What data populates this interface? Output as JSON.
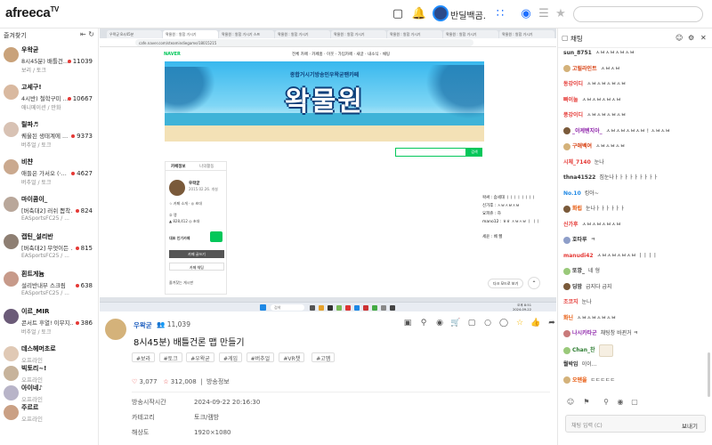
{
  "brand": {
    "logo": "afreeca",
    "logo_tv": "TV"
  },
  "header": {
    "user_name": "반딜백곰.",
    "icons": [
      "broadcast-icon",
      "bell-icon",
      "apps-icon",
      "chat-bubble-icon",
      "menu-icon",
      "star-icon"
    ]
  },
  "sidebar": {
    "title": "즐겨찾기",
    "items": [
      {
        "name": "우왁굳",
        "title": "8시45분) 배틀건...",
        "category": "보리 / 토크",
        "viewers": "11039",
        "online": true
      },
      {
        "name": "고세구!",
        "title": "4시반) 철학구미 ...",
        "category": "애니메이션 / 만화",
        "viewers": "10667",
        "online": true
      },
      {
        "name": "릴파♬",
        "title": "퀘울된 생태계에 ...",
        "category": "버추얼 / 토크",
        "viewers": "9373",
        "online": true
      },
      {
        "name": "비챤",
        "title": "애들은 가서오 (·...",
        "category": "버추얼 / 토크",
        "viewers": "4627",
        "online": true
      },
      {
        "name": "마이콤이_",
        "title": "[버축대2] 러쉬 뽑착...",
        "category": "EASportsFC25 / ...",
        "viewers": "824",
        "online": true
      },
      {
        "name": "캡틴_설리반",
        "title": "[버축대2] 무엇이든 ...",
        "category": "EASportsFC25 / ...",
        "viewers": "815",
        "online": true
      },
      {
        "name": "흰트게늄",
        "title": "설리반내부 스크림",
        "category": "EASportsFC25 / ...",
        "viewers": "638",
        "online": true
      },
      {
        "name": "이르_MIR",
        "title": "콘서트 후열! 이무지...",
        "category": "버추얼 / 토크",
        "viewers": "386",
        "online": true
      },
      {
        "name": "데스헤머초로",
        "offline": "오프라인"
      },
      {
        "name": "빅토리~!",
        "offline": "오프라인"
      },
      {
        "name": "아이네♪",
        "offline": "오프라인"
      },
      {
        "name": "주르르",
        "offline": "오프라인"
      }
    ]
  },
  "browser": {
    "tabs": [
      "우왁굳 8시45분",
      "왁물원 : 왕합 거시기",
      "왁물원 : 왕합 거시기 스프",
      "왁물원 : 왕합 거시기",
      "왁물원 : 왕합 거시기",
      "왁물원 : 왕합 거시기",
      "왁물원 : 왕합 거시기",
      "왁물원 : 왕합 거시기"
    ],
    "url": "cafe.naver.com/steamindiegame/18015215",
    "naver_logo": "NAVER",
    "nav_menu": "전체 카페 · 카페홈 · 이웃 · 가입카페 · 새글 · 내소식 · 채팅",
    "banner_subtitle": "종합거시기방송인우왁굳팬카페",
    "banner_title": "왁물원",
    "search_btn": "검색",
    "left_tabs": [
      "카페정보",
      "나의활동"
    ],
    "cafe_owner": "우왁굳",
    "cafe_since": "2015.02.26. 개설",
    "cafe_lines": [
      "☆ 카페 소개 · ◎ 초대",
      "② 랭",
      "▲ 828,412  ◎ 초대"
    ],
    "cafe_popular": "대표 인기카페",
    "write_btn": "카페 글쓰기",
    "chat_btn": "카페 채팅",
    "fav_label": "즐겨찾는 게시판",
    "right_lines": [
      "왁싸 : 슴세대 ㅣㅣㅣㅣㅣㅣㅣㅣ",
      "신가후 : ㅅㅂㅅㅂㅅㅂ",
      "요피쥬 : 하",
      "mano12 : ㅎㅎ ㅅㅂㅅㅂ ㅣ ㅣㅣ",
      "세윤 : 베 헬"
    ],
    "dark_mode": "다크 모드로 보기",
    "taskbar_search": "검색",
    "taskbar_time": "오후 8:51",
    "taskbar_date": "2024-09-22"
  },
  "stream_info": {
    "streamer": "우왁굳",
    "viewers": "11,039",
    "title": "8시45분) 배틀건론 맵 만들기",
    "tags": [
      "#보라",
      "#토크",
      "#우왁굳",
      "#게임",
      "#버추얼",
      "#VR챗",
      "#고멤"
    ],
    "likes": "3,077",
    "favorites": "312,008",
    "info_label": "방송정보",
    "meta": [
      {
        "key": "방송시작시간",
        "value": "2024-09-22 20:16:30"
      },
      {
        "key": "카테고리",
        "value": "토크/캠방"
      },
      {
        "key": "해상도",
        "value": "1920×1080"
      }
    ]
  },
  "chat": {
    "title": "채팅",
    "messages": [
      {
        "user": "sun_8751",
        "text": "ㅅㅂㅅㅂㅅㅂㅅㅂ",
        "color": "#333333"
      },
      {
        "user": "고릴라인트",
        "text": "ㅅㅂㅅㅂ",
        "color": "#d84315",
        "avatar": true
      },
      {
        "user": "동강이디",
        "text": "ㅅㅂㅅㅂㅅㅂㅅㅂ",
        "color": "#e53935"
      },
      {
        "user": "빠이눌",
        "text": "ㅅㅂㅅㅂㅅㅂㅅㅂ",
        "color": "#e53935"
      },
      {
        "user": "풍강이디",
        "text": "ㅅㅂㅅㅂㅅㅂㅅㅂ",
        "color": "#e53935"
      },
      {
        "user": "_이케텐지아_",
        "text": "ㅅㅂㅅㅂㅅㅂㅅㅂ ! ㅅㅂㅅㅂ",
        "color": "#8e24aa",
        "avatar": true
      },
      {
        "user": "구애벡여",
        "text": "ㅅㅂㅅㅂㅅㅂ",
        "color": "#d84315",
        "avatar": true
      },
      {
        "user": "시체_7140",
        "text": "눈나",
        "color": "#e53935"
      },
      {
        "user": "thna41522",
        "text": "짐눈나ㅏㅏㅏㅏㅏㅏㅏㅏㅏ",
        "color": "#333333"
      },
      {
        "user": "No.10",
        "text": "킹아~",
        "color": "#1e88e5"
      },
      {
        "user": "화립",
        "text": "눈나ㅏㅏㅏㅏㅏㅏ",
        "color": "#e65100",
        "avatar": true
      },
      {
        "user": "신가후",
        "text": "ㅅㅂㅅㅂㅅㅂㅅㅂ",
        "color": "#e53935"
      },
      {
        "user": "호타루",
        "text": "ㅋ",
        "color": "#333333",
        "avatar": true
      },
      {
        "user": "manudi42",
        "text": "ㅅㅂㅅㅂㅅㅂㅅㅂ ㅣㅣㅣㅣ",
        "color": "#e53935"
      },
      {
        "user": "또깡_",
        "text": "네 형",
        "color": "#333333",
        "avatar": true
      },
      {
        "user": "딩밤",
        "text": "급지다 급지",
        "color": "#333333",
        "avatar": true
      },
      {
        "user": "조코지",
        "text": "눈나",
        "color": "#e53935"
      },
      {
        "user": "화닌",
        "text": "ㅅㅂㅅㅂㅅㅂㅅㅂ",
        "color": "#e65100"
      },
      {
        "user": "나시카타군",
        "text": "채팅창 바뀐거 ㅋ",
        "color": "#8e24aa",
        "avatar": true
      },
      {
        "user": "Chan_찬",
        "text": "",
        "color": "#2e7d32",
        "avatar": true
      },
      {
        "user": "뭘박임",
        "text": "이이...",
        "color": "#333333"
      },
      {
        "user": "오덴을",
        "text": "ㄷㄷㄷㄷㄷ",
        "color": "#e65100",
        "avatar": true
      }
    ],
    "input_placeholder": "채팅 입력 (C)",
    "send_label": "보내기"
  }
}
